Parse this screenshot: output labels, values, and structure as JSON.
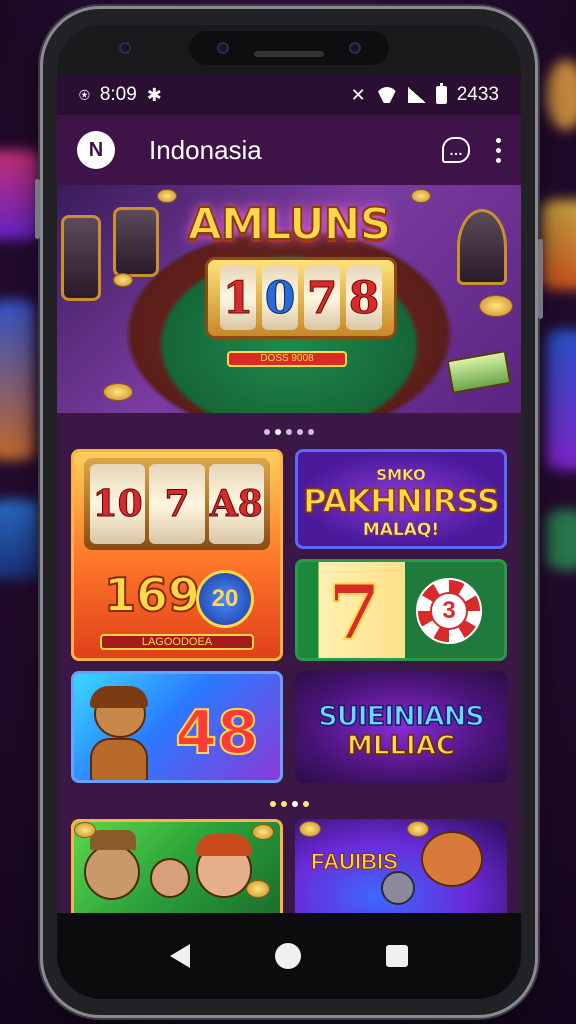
{
  "status_bar": {
    "left_text": "8:09",
    "time": "2433"
  },
  "app_bar": {
    "title": "Indonasia",
    "logo_glyph": "N",
    "chat_glyph": "…"
  },
  "hero": {
    "title": "AMLUNS",
    "reels": [
      "1",
      "0",
      "7",
      "8"
    ],
    "plate_text": "DOSS 9008"
  },
  "carousel_top": {
    "count": 5,
    "active": 2
  },
  "tiles": {
    "slot_reels": [
      "10",
      "7",
      "A8"
    ],
    "slot_number": "169",
    "slot_badge": "20",
    "slot_bar": "LAGOODOEA",
    "pakhnirss_small": "SMKO",
    "pakhnirss_title": "PAKHNIRSS",
    "pakhnirss_sub": "MALAQ!",
    "seven": "7",
    "chip_number": "3",
    "forty_eight": "48",
    "suieinians_title": "SUIEINIANS",
    "suieinians_sub": "MLLIAC",
    "fauibis_title": "FAUIBIS"
  },
  "carousel_bottom": {
    "count": 4
  },
  "colors": {
    "app_bar": "#3e1348",
    "accent_gold": "#ffd84a",
    "nav_bar": "#0c0c0e"
  },
  "icons": {
    "nfc": "nfc-icon",
    "bug": "bug-icon",
    "mute": "mute-icon",
    "wifi": "wifi-icon",
    "signal": "signal-icon",
    "battery": "battery-icon"
  }
}
